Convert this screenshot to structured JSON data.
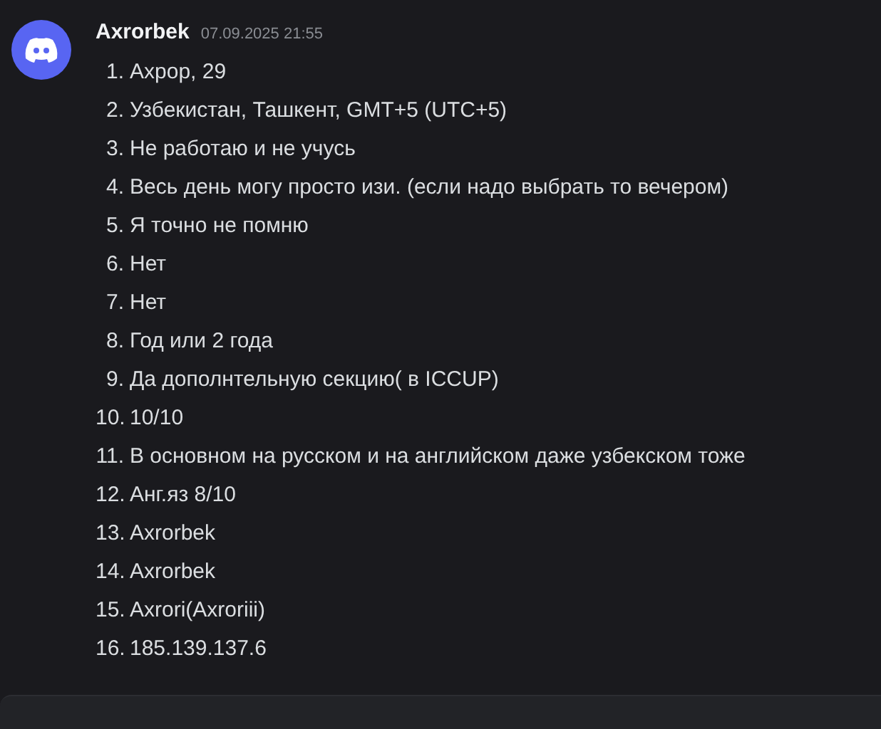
{
  "message": {
    "author": "Axrorbek",
    "timestamp": "07.09.2025 21:55",
    "items": [
      {
        "number": "1.",
        "text": "Ахрор, 29"
      },
      {
        "number": "2.",
        "text": "Узбекистан, Ташкент, GMT+5 (UTC+5)"
      },
      {
        "number": "3.",
        "text": "Не работаю и не учусь"
      },
      {
        "number": "4.",
        "text": "Весь день могу просто изи. (если надо выбрать то вечером)"
      },
      {
        "number": "5.",
        "text": "Я точно не помню"
      },
      {
        "number": "6.",
        "text": "Нет"
      },
      {
        "number": "7.",
        "text": "Нет"
      },
      {
        "number": "8.",
        "text": "Год или 2 года"
      },
      {
        "number": "9.",
        "text": "Да дополнтельную секцию( в ICCUP)"
      },
      {
        "number": "10.",
        "text": "10/10"
      },
      {
        "number": "11.",
        "text": "В основном на русском и на английском даже узбекском тоже"
      },
      {
        "number": "12.",
        "text": "Анг.яз 8/10"
      },
      {
        "number": "13.",
        "text": "Axrorbek"
      },
      {
        "number": "14.",
        "text": "Axrorbek"
      },
      {
        "number": "15.",
        "text": "Axrori(Axroriii)"
      },
      {
        "number": "16.",
        "text": "185.139.137.6"
      }
    ]
  }
}
